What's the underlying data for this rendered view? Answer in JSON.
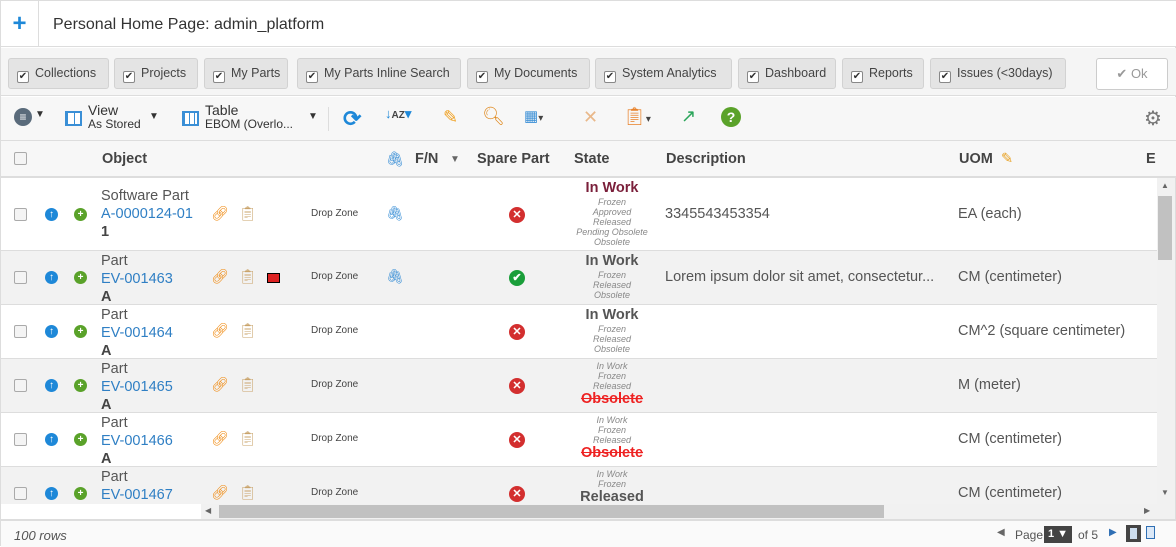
{
  "header": {
    "title": "Personal Home Page: admin_platform",
    "add_icon": "plus-icon"
  },
  "filters": [
    {
      "label": "Collections",
      "checked": true
    },
    {
      "label": "Projects",
      "checked": true
    },
    {
      "label": "My Parts",
      "checked": true
    },
    {
      "label": "My Parts Inline Search",
      "checked": true
    },
    {
      "label": "My Documents",
      "checked": true
    },
    {
      "label": "System Analytics",
      "checked": true
    },
    {
      "label": "Dashboard",
      "checked": true
    },
    {
      "label": "Reports",
      "checked": true
    },
    {
      "label": "Issues (<30days)",
      "checked": true
    }
  ],
  "ok_label": "Ok",
  "toolbar": {
    "view_label": "View",
    "view_value": "As Stored",
    "table_label": "Table",
    "table_value": "EBOM (Overlo..."
  },
  "columns": {
    "object": "Object",
    "fn": "F/N",
    "spare": "Spare Part",
    "state": "State",
    "description": "Description",
    "uom": "UOM",
    "e": "E"
  },
  "rows": [
    {
      "type": "Software Part",
      "id": "A-0000124-01",
      "rev": "1",
      "drop": "Drop Zone",
      "attach": true,
      "extra": false,
      "spare": "no",
      "states": [
        "Frozen",
        "Approved",
        "Released",
        "Pending Obsolete",
        "Obsolete"
      ],
      "current": "In Work",
      "current_pos": "top",
      "current_style": "maroon",
      "description": "3345543453354",
      "uom": "EA (each)"
    },
    {
      "type": "Part",
      "id": "EV-001463",
      "rev": "A",
      "drop": "Drop Zone",
      "attach": true,
      "extra": true,
      "spare": "yes",
      "states": [
        "Frozen",
        "Released",
        "Obsolete"
      ],
      "current": "In Work",
      "current_pos": "top",
      "current_style": "normal",
      "description": "Lorem ipsum dolor sit amet, consectetur...",
      "uom": "CM (centimeter)"
    },
    {
      "type": "Part",
      "id": "EV-001464",
      "rev": "A",
      "drop": "Drop Zone",
      "attach": false,
      "extra": false,
      "spare": "no",
      "states": [
        "Frozen",
        "Released",
        "Obsolete"
      ],
      "current": "In Work",
      "current_pos": "top",
      "current_style": "normal",
      "description": "",
      "uom": "CM^2 (square centimeter)"
    },
    {
      "type": "Part",
      "id": "EV-001465",
      "rev": "A",
      "drop": "Drop Zone",
      "attach": false,
      "extra": false,
      "spare": "no",
      "states": [
        "In Work",
        "Frozen",
        "Released"
      ],
      "current": "Obsolete",
      "current_pos": "bottom",
      "current_style": "red",
      "description": "",
      "uom": "M (meter)"
    },
    {
      "type": "Part",
      "id": "EV-001466",
      "rev": "A",
      "drop": "Drop Zone",
      "attach": false,
      "extra": false,
      "spare": "no",
      "states": [
        "In Work",
        "Frozen",
        "Released"
      ],
      "current": "Obsolete",
      "current_pos": "bottom",
      "current_style": "red",
      "description": "",
      "uom": "CM (centimeter)"
    },
    {
      "type": "Part",
      "id": "EV-001467",
      "rev": "A",
      "drop": "Drop Zone",
      "attach": false,
      "extra": false,
      "spare": "no",
      "states": [
        "In Work",
        "Frozen"
      ],
      "current": "Released",
      "current_pos": "bottom",
      "current_style": "normal",
      "description": "",
      "uom": "CM (centimeter)"
    }
  ],
  "footer": {
    "rows": "100 rows",
    "page_label": "Page",
    "page": "1",
    "of": "of 5"
  }
}
